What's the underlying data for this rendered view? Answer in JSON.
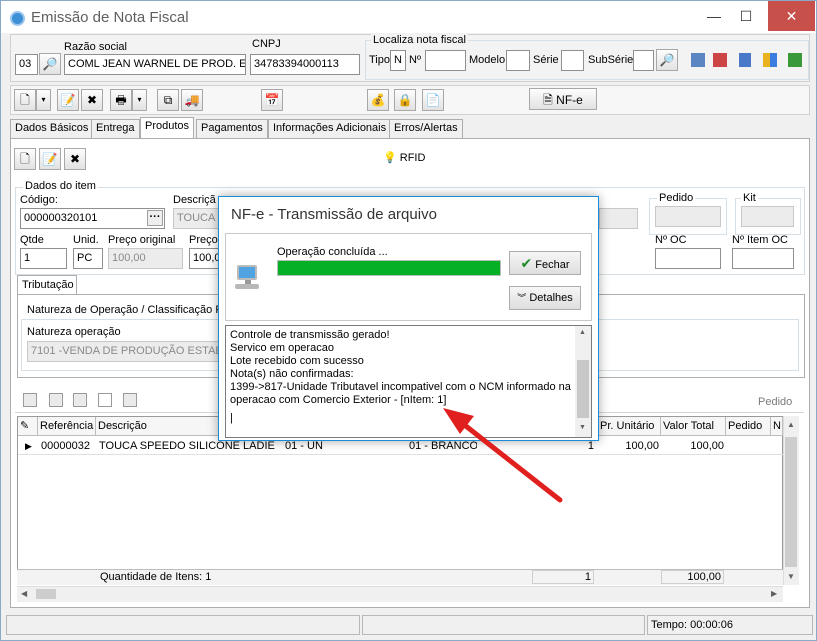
{
  "window": {
    "title": "Emissão de Nota Fiscal",
    "minimize": "—",
    "maximize": "☐",
    "close": "✕"
  },
  "header": {
    "razao_social_label": "Razão social",
    "cnpj_label": "CNPJ",
    "code": "03",
    "razao_social": "COML JEAN WARNEL DE PROD. ESP.",
    "cnpj": "34783394000113",
    "localiza_label": "Localiza nota fiscal",
    "tipo_label": "Tipo",
    "tipo_value": "N",
    "numero_label": "Nº",
    "modelo_label": "Modelo",
    "serie_label": "Série",
    "subserie_label": "SubSérie"
  },
  "toolbar": {
    "nfe_label": "NF-e"
  },
  "tabs": [
    {
      "label": "Dados Básicos"
    },
    {
      "label": "Entrega"
    },
    {
      "label": "Produtos"
    },
    {
      "label": "Pagamentos"
    },
    {
      "label": "Informações Adicionais"
    },
    {
      "label": "Erros/Alertas"
    }
  ],
  "products": {
    "rfid_label": "RFID",
    "dados_item_label": "Dados do item",
    "codigo_label": "Código:",
    "codigo_value": "000000320101",
    "descricao_label": "Descriçã",
    "descricao_value": "TOUCA",
    "pedido_label": "Pedido",
    "kit_label": "Kit",
    "qtde_label": "Qtde",
    "qtde_value": "1",
    "unid_label": "Unid.",
    "unid_value": "PC",
    "preco_original_label": "Preço original",
    "preco_original_value": "100,00",
    "preco_label": "Preço",
    "preco_value": "100,0",
    "no_oc_label": "Nº OC",
    "no_item_oc_label": "Nº Item OC",
    "tributacao_label": "Tributação",
    "natureza_class_label": "Natureza de Operação / Classificação Fi",
    "natureza_label": "Natureza operação",
    "natureza_value": "7101 -VENDA DE PRODUÇÃO ESTAB"
  },
  "grid": {
    "pedido_toolbar_label": "Pedido",
    "columns": [
      "Referência",
      "Descrição",
      "Pr. Unitário",
      "Valor Total",
      "Pedido",
      "N"
    ],
    "row": {
      "ref": "00000032",
      "desc": "TOUCA SPEEDO SILICONE LADIES R",
      "size": "01 - UN",
      "color": "01 - BRANCO",
      "qty": "1",
      "unit": "100,00",
      "total": "100,00"
    },
    "footer": {
      "qtd_label": "Quantidade de Itens: 1",
      "qty_total": "1",
      "value_total": "100,00"
    }
  },
  "status": {
    "tempo": "Tempo: 00:00:06"
  },
  "dialog": {
    "title": "NF-e - Transmissão de arquivo",
    "status": "Operação concluída ...",
    "progress": 1.0,
    "fechar": "Fechar",
    "detalhes": "Detalhes",
    "log": [
      "Controle de transmissão gerado!",
      "Servico em operacao",
      "Lote recebido com sucesso",
      "Nota(s) não confirmadas:",
      "1399->817-Unidade Tributavel incompativel com o NCM informado na",
      "operacao com Comercio Exterior - [nItem: 1]"
    ]
  },
  "colors": {
    "accent": "#1a8bd9",
    "progress": "#06b025",
    "arrow": "#e0201e",
    "close": "#c7504b"
  }
}
